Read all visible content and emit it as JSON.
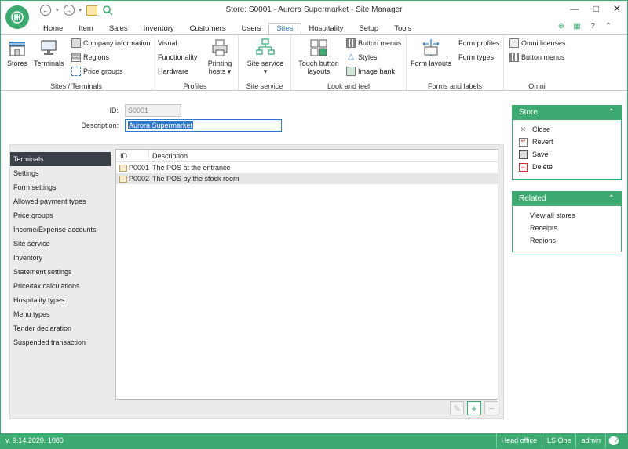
{
  "window": {
    "title": "Store: S0001 - Aurora Supermarket - Site Manager"
  },
  "tabs": [
    {
      "label": "Home"
    },
    {
      "label": "Item"
    },
    {
      "label": "Sales"
    },
    {
      "label": "Inventory"
    },
    {
      "label": "Customers"
    },
    {
      "label": "Users"
    },
    {
      "label": "Sites",
      "active": true
    },
    {
      "label": "Hospitality"
    },
    {
      "label": "Setup"
    },
    {
      "label": "Tools"
    }
  ],
  "ribbon": {
    "sites_terminals": {
      "label": "Sites / Terminals",
      "stores": "Stores",
      "terminals": "Terminals",
      "company_information": "Company information",
      "regions": "Regions",
      "price_groups": "Price groups"
    },
    "profiles": {
      "label": "Profiles",
      "visual": "Visual",
      "functionality": "Functionality",
      "hardware": "Hardware",
      "printing_hosts": "Printing hosts"
    },
    "site_service": {
      "label": "Site service",
      "site_service": "Site service"
    },
    "look_and_feel": {
      "label": "Look and feel",
      "touch_button_layouts": "Touch button layouts",
      "button_menus": "Button menus",
      "styles": "Styles",
      "image_bank": "Image bank"
    },
    "forms_labels": {
      "label": "Forms and labels",
      "form_layouts": "Form layouts",
      "form_profiles": "Form profiles",
      "form_types": "Form types"
    },
    "omni": {
      "label": "Omni",
      "omni_licenses": "Omni licenses",
      "button_menus": "Button menus"
    }
  },
  "form": {
    "id_label": "ID:",
    "id_value": "S0001",
    "description_label": "Description:",
    "description_value": "Aurora Supermarket"
  },
  "nav": [
    {
      "label": "Terminals",
      "active": true
    },
    {
      "label": "Settings"
    },
    {
      "label": "Form settings"
    },
    {
      "label": "Allowed payment types"
    },
    {
      "label": "Price groups"
    },
    {
      "label": "Income/Expense accounts"
    },
    {
      "label": "Site service"
    },
    {
      "label": "Inventory"
    },
    {
      "label": "Statement settings"
    },
    {
      "label": "Price/tax calculations"
    },
    {
      "label": "Hospitality types"
    },
    {
      "label": "Menu types"
    },
    {
      "label": "Tender declaration"
    },
    {
      "label": "Suspended transaction"
    }
  ],
  "grid": {
    "columns": [
      "ID",
      "Description"
    ],
    "rows": [
      {
        "id": "P0001",
        "description": "The POS at the entrance"
      },
      {
        "id": "P0002",
        "description": "The POS by the stock room",
        "selected": true
      }
    ]
  },
  "store_panel": {
    "title": "Store",
    "items": [
      {
        "label": "Close",
        "icon": "close-icon"
      },
      {
        "label": "Revert",
        "icon": "revert-icon"
      },
      {
        "label": "Save",
        "icon": "save-icon"
      },
      {
        "label": "Delete",
        "icon": "delete-icon"
      }
    ]
  },
  "related_panel": {
    "title": "Related",
    "items": [
      {
        "label": "View all stores"
      },
      {
        "label": "Receipts"
      },
      {
        "label": "Regions"
      }
    ]
  },
  "statusbar": {
    "version": "v. 9.14.2020. 1080",
    "location": "Head office",
    "product": "LS One",
    "user": "admin"
  },
  "colors": {
    "accent": "#3daa72",
    "nav_active": "#3a4149",
    "selection": "#3076c9"
  }
}
